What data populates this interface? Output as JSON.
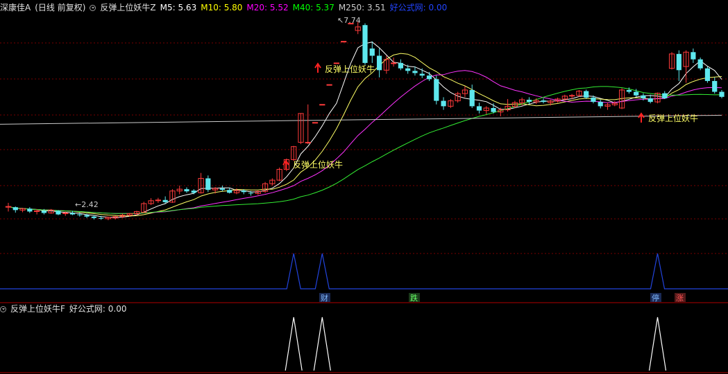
{
  "header": {
    "stock": "深康佳A",
    "period": "(日线 前复权)",
    "indicator": "反弹上位妖牛Z",
    "ma": [
      {
        "label": "M5: 5.63",
        "color": "#ffffff"
      },
      {
        "label": "M10: 5.80",
        "color": "#ffff00"
      },
      {
        "label": "M20: 5.52",
        "color": "#ff00ff"
      },
      {
        "label": "M40: 5.37",
        "color": "#00ff00"
      },
      {
        "label": "M250: 3.51",
        "color": "#cccccc"
      }
    ],
    "site": "好公式网: 0.00",
    "site_color": "#2244ff"
  },
  "sub_header": {
    "indicator": "反弹上位妖牛F",
    "site": "好公式网: 0.00"
  },
  "annotations": {
    "high": "7.74",
    "low": "2.42",
    "signal": "反弹上位妖牛"
  },
  "markers": [
    {
      "id": "cai",
      "text": "财",
      "color": "#7fb8ff"
    },
    {
      "id": "die",
      "text": "跌",
      "color": "#66ff66"
    },
    {
      "id": "ting",
      "text": "停",
      "color": "#7fb8ff"
    },
    {
      "id": "zhang",
      "text": "涨",
      "color": "#ff5555"
    }
  ],
  "colors": {
    "bull": "#ff3b3b",
    "bear": "#5ee8ee",
    "ma5": "#ffffff",
    "ma10": "#ffff66",
    "ma20": "#ff33ff",
    "ma40": "#33ee33",
    "ma250": "#cccccc",
    "signal_line": "#2244dd",
    "grid": "#7a0000"
  },
  "chart_data": {
    "type": "candlestick",
    "price_range": [
      2.2,
      8.0
    ],
    "candles": [
      [
        2.6,
        2.72,
        2.48,
        2.62
      ],
      [
        2.6,
        2.62,
        2.45,
        2.52
      ],
      [
        2.52,
        2.58,
        2.46,
        2.56
      ],
      [
        2.56,
        2.6,
        2.44,
        2.48
      ],
      [
        2.48,
        2.55,
        2.4,
        2.5
      ],
      [
        2.5,
        2.55,
        2.4,
        2.44
      ],
      [
        2.44,
        2.55,
        2.42,
        2.52
      ],
      [
        2.5,
        2.52,
        2.38,
        2.4
      ],
      [
        2.42,
        2.48,
        2.36,
        2.44
      ],
      [
        2.44,
        2.5,
        2.38,
        2.4
      ],
      [
        2.4,
        2.45,
        2.34,
        2.38
      ],
      [
        2.38,
        2.42,
        2.3,
        2.34
      ],
      [
        2.34,
        2.38,
        2.26,
        2.3
      ],
      [
        2.3,
        2.36,
        2.25,
        2.28
      ],
      [
        2.28,
        2.34,
        2.24,
        2.32
      ],
      [
        2.3,
        2.36,
        2.26,
        2.34
      ],
      [
        2.34,
        2.42,
        2.3,
        2.38
      ],
      [
        2.38,
        2.44,
        2.34,
        2.42
      ],
      [
        2.42,
        2.5,
        2.38,
        2.48
      ],
      [
        2.46,
        2.75,
        2.44,
        2.7
      ],
      [
        2.7,
        2.85,
        2.66,
        2.78
      ],
      [
        2.78,
        2.86,
        2.72,
        2.8
      ],
      [
        2.8,
        2.9,
        2.7,
        2.74
      ],
      [
        2.74,
        3.1,
        2.72,
        3.05
      ],
      [
        3.05,
        3.2,
        2.96,
        3.1
      ],
      [
        3.1,
        3.15,
        3.0,
        3.04
      ],
      [
        3.06,
        3.1,
        2.96,
        3.0
      ],
      [
        3.0,
        3.55,
        2.98,
        3.4
      ],
      [
        3.4,
        3.48,
        3.02,
        3.08
      ],
      [
        3.08,
        3.16,
        2.98,
        3.12
      ],
      [
        3.12,
        3.2,
        3.04,
        3.08
      ],
      [
        3.08,
        3.14,
        2.98,
        3.0
      ],
      [
        3.0,
        3.12,
        2.96,
        3.06
      ],
      [
        3.06,
        3.1,
        2.96,
        3.02
      ],
      [
        3.0,
        3.05,
        2.92,
        2.98
      ],
      [
        2.98,
        3.06,
        2.94,
        3.04
      ],
      [
        3.04,
        3.3,
        3.0,
        3.25
      ],
      [
        3.25,
        3.4,
        3.2,
        3.35
      ],
      [
        3.35,
        3.7,
        3.32,
        3.65
      ],
      [
        3.65,
        3.95,
        3.6,
        3.92
      ],
      [
        3.92,
        4.3,
        3.88,
        4.28
      ],
      [
        4.4,
        5.2,
        4.35,
        5.2
      ],
      [
        4.4,
        5.45,
        4.35,
        4.4
      ],
      [
        4.95,
        4.95,
        4.95,
        4.95
      ],
      [
        5.45,
        5.45,
        5.45,
        5.45
      ],
      [
        6.0,
        6.0,
        6.0,
        6.0
      ],
      [
        6.6,
        6.6,
        6.6,
        6.6
      ],
      [
        7.2,
        7.2,
        7.2,
        7.2
      ],
      [
        7.7,
        7.7,
        7.7,
        7.7
      ],
      [
        7.5,
        7.74,
        7.4,
        7.6
      ],
      [
        7.65,
        7.7,
        6.55,
        6.6
      ],
      [
        7.0,
        7.2,
        6.6,
        6.8
      ],
      [
        6.8,
        7.0,
        6.2,
        6.4
      ],
      [
        6.4,
        6.8,
        6.3,
        6.7
      ],
      [
        6.6,
        6.75,
        6.5,
        6.6
      ],
      [
        6.6,
        6.7,
        6.4,
        6.45
      ],
      [
        6.45,
        6.55,
        6.3,
        6.38
      ],
      [
        6.38,
        6.5,
        6.25,
        6.32
      ],
      [
        6.3,
        6.45,
        6.18,
        6.25
      ],
      [
        6.25,
        6.35,
        6.1,
        6.15
      ],
      [
        6.15,
        6.25,
        5.45,
        5.55
      ],
      [
        5.55,
        5.65,
        5.3,
        5.4
      ],
      [
        5.4,
        5.6,
        5.35,
        5.55
      ],
      [
        5.55,
        5.8,
        5.5,
        5.75
      ],
      [
        5.75,
        5.95,
        5.65,
        5.85
      ],
      [
        5.85,
        6.0,
        5.35,
        5.4
      ],
      [
        5.4,
        5.5,
        5.2,
        5.28
      ],
      [
        5.28,
        5.4,
        5.18,
        5.35
      ],
      [
        5.35,
        5.48,
        5.2,
        5.24
      ],
      [
        5.24,
        5.36,
        5.12,
        5.3
      ],
      [
        5.3,
        5.6,
        5.25,
        5.4
      ],
      [
        5.4,
        5.55,
        5.35,
        5.5
      ],
      [
        5.5,
        5.64,
        5.42,
        5.58
      ],
      [
        5.58,
        5.65,
        5.45,
        5.52
      ],
      [
        5.52,
        5.62,
        5.46,
        5.56
      ],
      [
        5.56,
        5.62,
        5.48,
        5.52
      ],
      [
        5.5,
        5.58,
        5.42,
        5.54
      ],
      [
        5.54,
        5.64,
        5.5,
        5.6
      ],
      [
        5.6,
        5.72,
        5.56,
        5.68
      ],
      [
        5.68,
        5.74,
        5.6,
        5.7
      ],
      [
        5.7,
        5.85,
        5.66,
        5.82
      ],
      [
        5.82,
        5.86,
        5.6,
        5.64
      ],
      [
        5.64,
        5.7,
        5.48,
        5.52
      ],
      [
        5.52,
        5.58,
        5.34,
        5.4
      ],
      [
        5.4,
        5.5,
        5.3,
        5.44
      ],
      [
        5.44,
        5.54,
        5.4,
        5.48
      ],
      [
        5.35,
        5.9,
        5.32,
        5.85
      ],
      [
        5.85,
        5.92,
        5.75,
        5.8
      ],
      [
        5.8,
        5.88,
        5.66,
        5.7
      ],
      [
        5.7,
        5.76,
        5.56,
        5.62
      ],
      [
        5.62,
        5.72,
        5.48,
        5.52
      ],
      [
        5.52,
        5.78,
        5.48,
        5.76
      ],
      [
        5.76,
        5.82,
        5.6,
        5.62
      ],
      [
        6.45,
        6.9,
        6.42,
        6.85
      ],
      [
        6.85,
        6.95,
        6.1,
        6.4
      ],
      [
        6.5,
        6.95,
        6.05,
        6.9
      ],
      [
        6.9,
        7.0,
        6.6,
        6.7
      ],
      [
        6.7,
        6.75,
        6.4,
        6.45
      ],
      [
        6.45,
        6.5,
        6.05,
        6.1
      ],
      [
        6.1,
        6.2,
        5.75,
        5.8
      ],
      [
        5.8,
        5.85,
        5.62,
        5.66
      ]
    ],
    "ma250": [
      [
        0,
        4.9
      ],
      [
        100,
        5.15
      ]
    ],
    "signal_peaks": [
      40,
      44,
      91
    ]
  }
}
